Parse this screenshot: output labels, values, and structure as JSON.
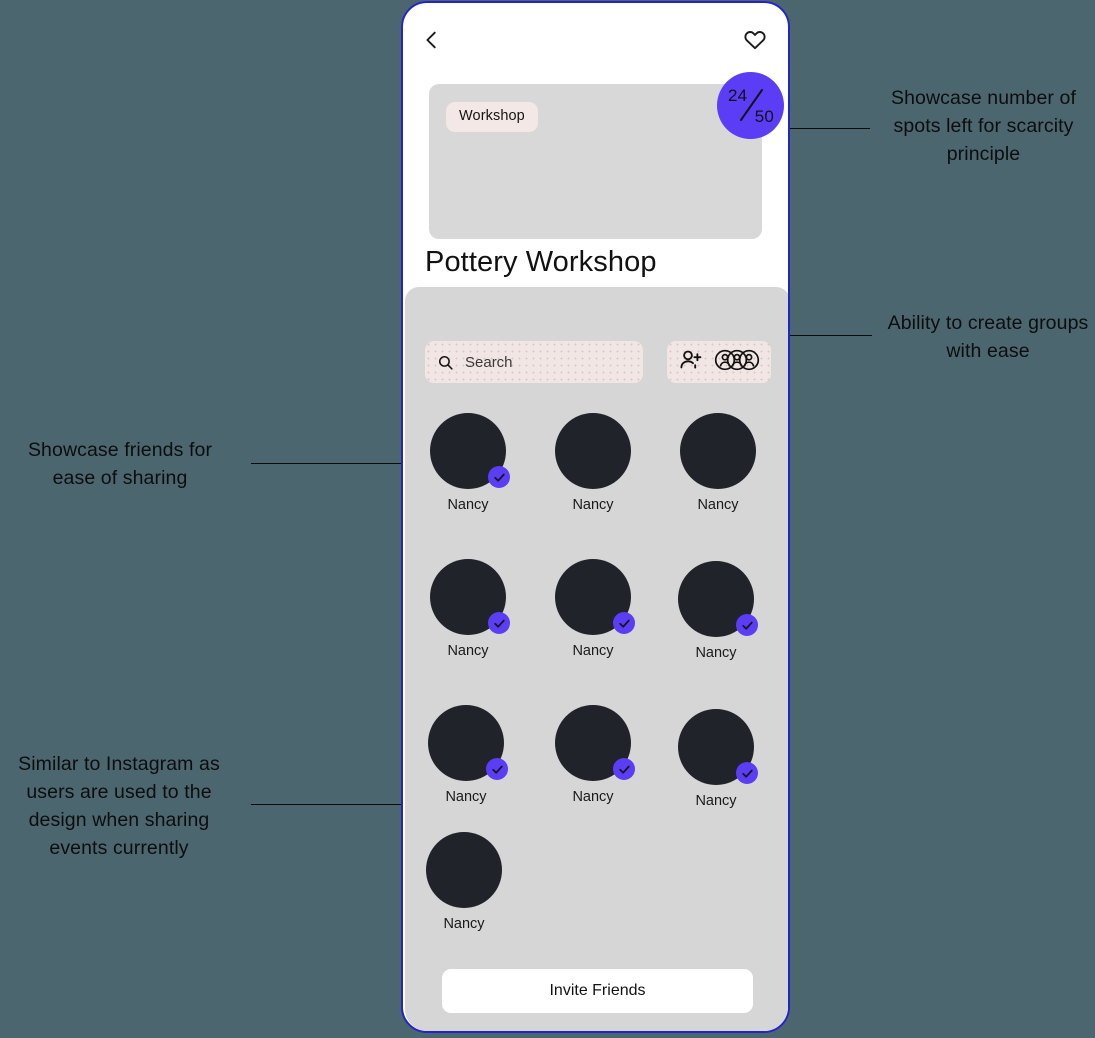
{
  "page": {
    "background_color": "#4c6670"
  },
  "phone": {
    "frame_border_color": "#2424c9",
    "topbar": {
      "back_icon": "chevron-left-icon",
      "favorite_icon": "heart-outline-icon"
    },
    "hero": {
      "category_chip": "Workshop",
      "scarcity_badge": {
        "taken": "24",
        "total": "50",
        "separator": "/",
        "color": "#5b3df5"
      }
    },
    "event_title": "Pottery Workshop",
    "sheet": {
      "search": {
        "icon": "search-icon",
        "placeholder": "Search",
        "value": "Search"
      },
      "group_actions": [
        {
          "name": "add-person-icon",
          "label": "Add person"
        },
        {
          "name": "create-group-icon",
          "label": "Create group"
        }
      ],
      "friends": [
        {
          "name": "Nancy",
          "selected": true
        },
        {
          "name": "Nancy",
          "selected": false
        },
        {
          "name": "Nancy",
          "selected": false
        },
        {
          "name": "Nancy",
          "selected": true
        },
        {
          "name": "Nancy",
          "selected": true
        },
        {
          "name": "Nancy",
          "selected": true
        },
        {
          "name": "Nancy",
          "selected": true
        },
        {
          "name": "Nancy",
          "selected": true
        },
        {
          "name": "Nancy",
          "selected": true
        },
        {
          "name": "Nancy",
          "selected": false
        }
      ],
      "invite_button_label": "Invite Friends"
    }
  },
  "annotations": {
    "scarcity": "Showcase number of spots left for scarcity principle",
    "groups": "Ability to create groups with ease",
    "friends": "Showcase friends for ease of sharing",
    "instagram": "Similar to Instagram as users are used to the design when sharing events currently"
  }
}
